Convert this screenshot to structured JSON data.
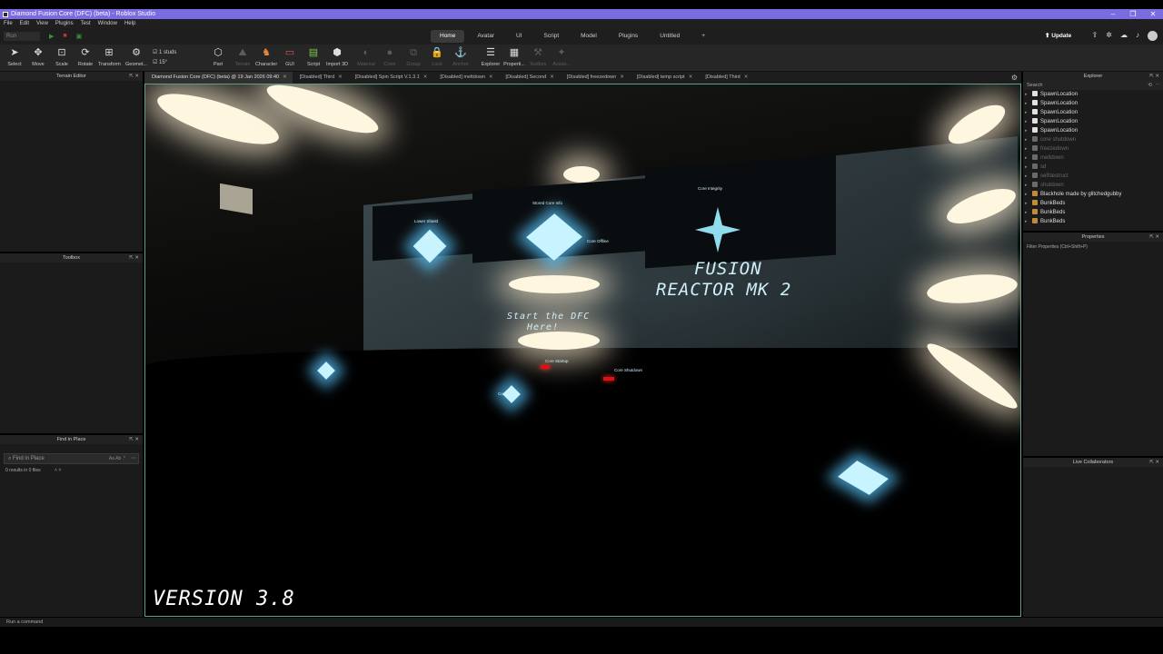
{
  "window": {
    "title": "Diamond Fusion Core (DFC) (beta) - Roblox Studio",
    "controls": [
      "–",
      "❐",
      "✕"
    ]
  },
  "menu": [
    "File",
    "Edit",
    "View",
    "Plugins",
    "Test",
    "Window",
    "Help"
  ],
  "run_select": "Run",
  "ribbon_tabs": [
    "Home",
    "Avatar",
    "UI",
    "Script",
    "Model",
    "Plugins",
    "Untitled",
    "+"
  ],
  "update_label": "Update",
  "tools": [
    {
      "label": "Select",
      "icon": "cursor-icon"
    },
    {
      "label": "Move",
      "icon": "move-icon"
    },
    {
      "label": "Scale",
      "icon": "scale-icon"
    },
    {
      "label": "Rotate",
      "icon": "rotate-icon"
    },
    {
      "label": "Transform",
      "icon": "transform-icon"
    },
    {
      "label": "Geomet...",
      "icon": "geometry-icon"
    },
    {
      "label": "Part",
      "icon": "part-icon"
    },
    {
      "label": "Terrain",
      "icon": "terrain-icon"
    },
    {
      "label": "Character",
      "icon": "character-icon"
    },
    {
      "label": "GUI",
      "icon": "gui-icon"
    },
    {
      "label": "Script",
      "icon": "script-icon"
    },
    {
      "label": "Import 3D",
      "icon": "import-icon"
    },
    {
      "label": "Material",
      "icon": "material-icon"
    },
    {
      "label": "Color",
      "icon": "color-icon"
    },
    {
      "label": "Group",
      "icon": "group-icon"
    },
    {
      "label": "Lock",
      "icon": "lock-icon"
    },
    {
      "label": "Anchor",
      "icon": "anchor-icon"
    },
    {
      "label": "Explorer",
      "icon": "explorer-icon"
    },
    {
      "label": "Properti...",
      "icon": "properties-icon"
    },
    {
      "label": "Toolbox",
      "icon": "toolbox-icon"
    },
    {
      "label": "Assist...",
      "icon": "assistant-icon"
    }
  ],
  "snap": {
    "move": "1 studs",
    "rotate": "15°"
  },
  "doc_tabs": [
    "Diamond Fusion Core (DFC) (beta) @ 19 Jan 2026 09:40",
    "[Disabled] Third",
    "[Disabled] Spin Script V.1.3.1",
    "[Disabled] meltdown",
    "[Disabled] Second",
    "[Disabled] freezedown",
    "[Disabled] temp script",
    "[Disabled] Third"
  ],
  "panels": {
    "terrain": "Terrain Editor",
    "toolbox": "Toolbox",
    "find": {
      "title": "Find in Place",
      "placeholder": "Find in Place",
      "count": "0 results in 0 files",
      "opts": "Aa  Ab  .*"
    }
  },
  "viewport": {
    "version": "VERSION 3.8",
    "sign_line1": "FUSION",
    "sign_line2": "REACTOR MK 2",
    "start_text1": "Start the DFC",
    "start_text2": "Here!",
    "labels": [
      "Core Integrity",
      "Stored Core Info",
      "Core Offline",
      "Core Shutdown",
      "Lower Shield",
      "Core Startup",
      "Core"
    ]
  },
  "explorer": {
    "title": "Explorer",
    "search": "Search",
    "items": [
      {
        "name": "SpawnLocation",
        "dim": false,
        "color": "#e0e0e0"
      },
      {
        "name": "SpawnLocation",
        "dim": false,
        "color": "#e0e0e0"
      },
      {
        "name": "SpawnLocation",
        "dim": false,
        "color": "#e0e0e0"
      },
      {
        "name": "SpawnLocation",
        "dim": false,
        "color": "#e0e0e0"
      },
      {
        "name": "SpawnLocation",
        "dim": false,
        "color": "#e0e0e0"
      },
      {
        "name": "core shutdown",
        "dim": true,
        "color": "#6a6a6a"
      },
      {
        "name": "freezedown",
        "dim": true,
        "color": "#6a6a6a"
      },
      {
        "name": "meltdown",
        "dim": true,
        "color": "#6a6a6a"
      },
      {
        "name": "sd",
        "dim": true,
        "color": "#6a6a6a"
      },
      {
        "name": "selfdestruct",
        "dim": true,
        "color": "#6a6a6a"
      },
      {
        "name": "shutdown",
        "dim": true,
        "color": "#6a6a6a"
      },
      {
        "name": "Blackhole made by glitchedgubby",
        "dim": false,
        "color": "#c08a3e"
      },
      {
        "name": "BunkBeds",
        "dim": false,
        "color": "#c08a3e"
      },
      {
        "name": "BunkBeds",
        "dim": false,
        "color": "#c08a3e"
      },
      {
        "name": "BunkBeds",
        "dim": false,
        "color": "#c08a3e"
      }
    ]
  },
  "properties": {
    "title": "Properties",
    "filter": "Filter Properties (Ctrl+Shift+P)"
  },
  "live": {
    "title": "Live Collaborators"
  },
  "command_placeholder": "Run a command",
  "colors": {
    "titlebar": "#7b6be3",
    "accent_green": "#5aa08a"
  }
}
